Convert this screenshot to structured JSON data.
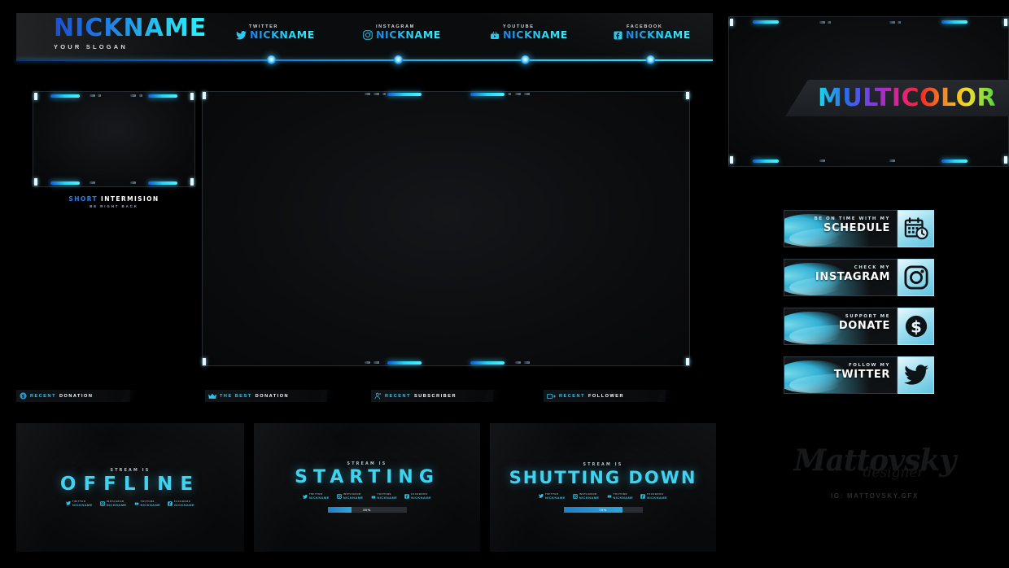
{
  "header": {
    "logo_name": "NICKNAME",
    "slogan": "YOUR SLOGAN",
    "socials": [
      {
        "platform": "TWITTER",
        "icon": "twitter-icon",
        "nick": "NICKNAME"
      },
      {
        "platform": "INSTAGRAM",
        "icon": "instagram-icon",
        "nick": "NICKNAME"
      },
      {
        "platform": "YOUTUBE",
        "icon": "youtube-icon",
        "nick": "NICKNAME"
      },
      {
        "platform": "FACEBOOK",
        "icon": "facebook-icon",
        "nick": "NICKNAME"
      }
    ]
  },
  "webcam": {
    "intermission_title_a": "SHORT",
    "intermission_title_b": "INTERMISION",
    "intermission_sub": "BE RIGHT BACK"
  },
  "alerts": [
    {
      "icon": "dollar-circle-icon",
      "t1": "RECENT",
      "t2": "DONATION"
    },
    {
      "icon": "crown-icon",
      "t1": "THE BEST",
      "t2": "DONATION"
    },
    {
      "icon": "user-add-icon",
      "t1": "RECENT",
      "t2": "SUBSCRIBER"
    },
    {
      "icon": "follower-icon",
      "t1": "RECENT",
      "t2": "FOLLOWER"
    }
  ],
  "multicolor": {
    "title": "MULTICOLOR",
    "gradient": [
      "#1fd8e8",
      "#2a6bf0",
      "#8b35e0",
      "#e51f8e",
      "#f02a2a",
      "#f58220",
      "#f2de2c",
      "#4fd63f"
    ]
  },
  "panels": [
    {
      "small": "BE ON TIME WITH MY",
      "big": "SCHEDULE",
      "icon": "calendar-clock-icon"
    },
    {
      "small": "CHECK MY",
      "big": "INSTAGRAM",
      "icon": "instagram-icon"
    },
    {
      "small": "SUPPORT ME",
      "big": "DONATE",
      "icon": "dollar-icon"
    },
    {
      "small": "FOLLOW MY",
      "big": "TWITTER",
      "icon": "twitter-icon"
    }
  ],
  "bottom_screens": [
    {
      "small": "STREAM IS",
      "big": "OFFLINE",
      "big_size": "23px",
      "big_spacing": "9px",
      "has_progress": false,
      "progress_pct": "",
      "socials": [
        {
          "icon": "twitter-icon",
          "l1": "TWITTER",
          "l2": "NICKNAME"
        },
        {
          "icon": "instagram-icon",
          "l1": "INSTAGRAM",
          "l2": "NICKNAME"
        },
        {
          "icon": "youtube-icon",
          "l1": "YOUTUBE",
          "l2": "NICKNAME"
        },
        {
          "icon": "facebook-icon",
          "l1": "FACEBOOK",
          "l2": "NICKNAME"
        }
      ]
    },
    {
      "small": "STREAM IS",
      "big": "STARTING",
      "big_size": "22px",
      "big_spacing": "7px",
      "has_progress": true,
      "progress_pct": "30%",
      "progress_fill": "30",
      "socials": [
        {
          "icon": "twitter-icon",
          "l1": "TWITTER",
          "l2": "NICKNAME"
        },
        {
          "icon": "instagram-icon",
          "l1": "INSTAGRAM",
          "l2": "NICKNAME"
        },
        {
          "icon": "youtube-icon",
          "l1": "YOUTUBE",
          "l2": "NICKNAME"
        },
        {
          "icon": "facebook-icon",
          "l1": "FACEBOOK",
          "l2": "NICKNAME"
        }
      ]
    },
    {
      "small": "STREAM IS",
      "big": "SHUTTING DOWN",
      "big_size": "21px",
      "big_spacing": "2px",
      "has_progress": true,
      "progress_pct": "75%",
      "progress_fill": "75",
      "socials": [
        {
          "icon": "twitter-icon",
          "l1": "TWITTER",
          "l2": "NICKNAME"
        },
        {
          "icon": "instagram-icon",
          "l1": "INSTAGRAM",
          "l2": "NICKNAME"
        },
        {
          "icon": "youtube-icon",
          "l1": "YOUTUBE",
          "l2": "NICKNAME"
        },
        {
          "icon": "facebook-icon",
          "l1": "FACEBOOK",
          "l2": "NICKNAME"
        }
      ]
    }
  ],
  "watermark": {
    "script": "Mattovsky",
    "script_sub": "designer",
    "ig": "IG: MATTOVSKY.GFX"
  },
  "colors": {
    "accent_cyan": "#2bd6f2",
    "accent_blue": "#1a4fd8",
    "bg": "#000000"
  }
}
